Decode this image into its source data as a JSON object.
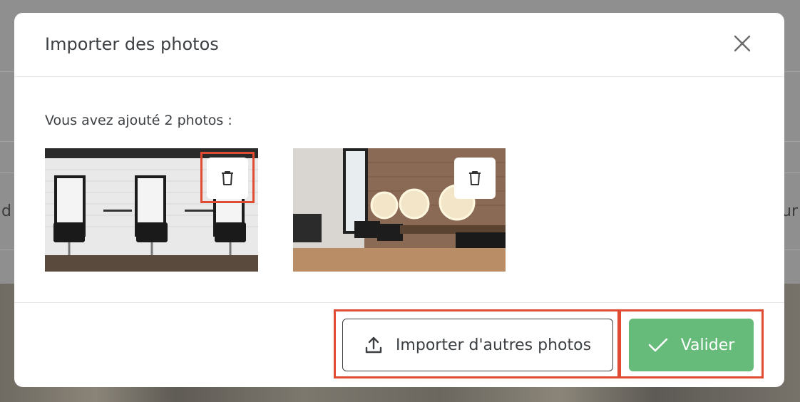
{
  "modal": {
    "title": "Importer des photos",
    "count_text": "Vous avez ajouté 2 photos :",
    "photos": [
      {
        "alt": "salon photo 1",
        "icon": "trash-icon"
      },
      {
        "alt": "salon photo 2",
        "icon": "trash-icon"
      }
    ],
    "buttons": {
      "import_label": "Importer d'autres photos",
      "validate_label": "Valider"
    }
  },
  "background": {
    "left_fragment": "d",
    "right_fragment": "ur"
  },
  "colors": {
    "accent_green": "#66bb7a",
    "highlight_red": "#e04b33",
    "text_dark": "#3c4043"
  }
}
